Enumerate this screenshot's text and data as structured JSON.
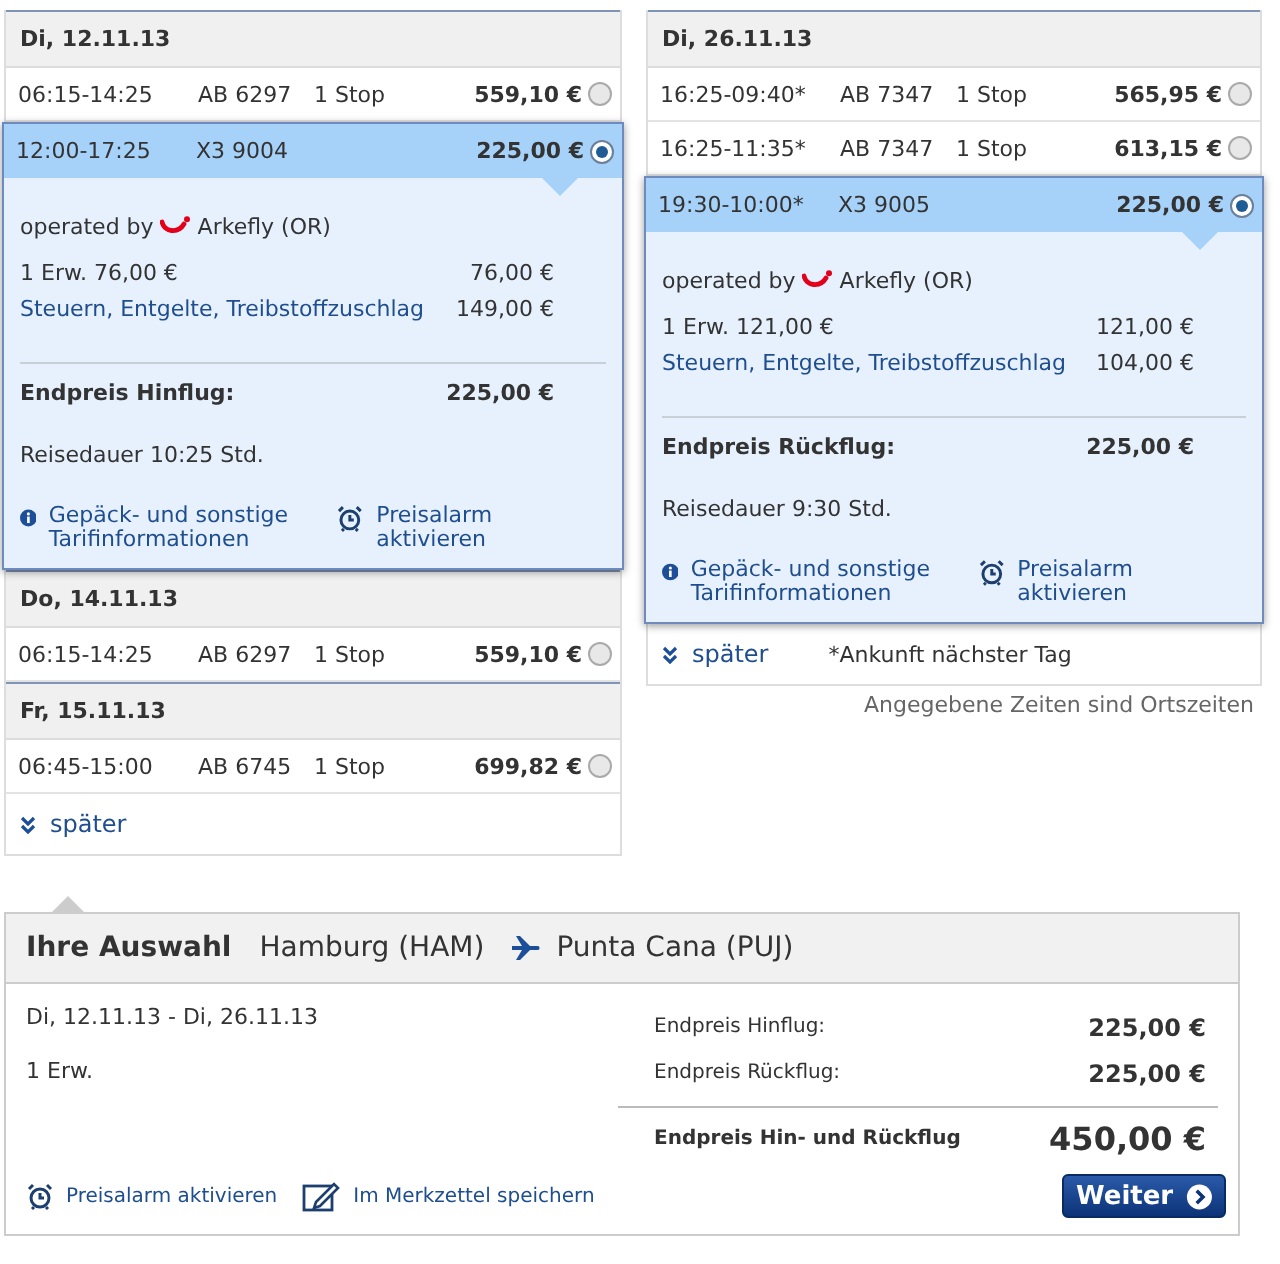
{
  "columns": [
    {
      "days": [
        {
          "date": "Di, 12.11.13",
          "flights": [
            {
              "times": "06:15-14:25",
              "code": "AB 6297",
              "stops": "1 Stop",
              "price": "559,10 €",
              "selected": false
            },
            {
              "times": "12:00-17:25",
              "code": "X3 9004",
              "price": "225,00 €",
              "selected": true,
              "details": {
                "operated_by": "operated by",
                "airline": "Arkefly (OR)",
                "fare_label": "1 Erw. 76,00 €",
                "fare_amount": "76,00 €",
                "taxes_label": "Steuern, Entgelte, Treibstoffzuschlag",
                "taxes_amount": "149,00 €",
                "total_label": "Endpreis Hinflug:",
                "total_amount": "225,00 €",
                "duration": "Reisedauer 10:25 Std.",
                "info_link": "Gepäck- und sonstige Tarifinformationen",
                "alarm_link": "Preisalarm aktivieren"
              }
            }
          ]
        },
        {
          "date": "Do, 14.11.13",
          "flights": [
            {
              "times": "06:15-14:25",
              "code": "AB 6297",
              "stops": "1 Stop",
              "price": "559,10 €",
              "selected": false
            }
          ]
        },
        {
          "date": "Fr, 15.11.13",
          "flights": [
            {
              "times": "06:45-15:00",
              "code": "AB 6745",
              "stops": "1 Stop",
              "price": "699,82 €",
              "selected": false
            }
          ]
        }
      ],
      "later": "später"
    },
    {
      "days": [
        {
          "date": "Di, 26.11.13",
          "flights": [
            {
              "times": "16:25-09:40*",
              "code": "AB 7347",
              "stops": "1 Stop",
              "price": "565,95 €",
              "selected": false
            },
            {
              "times": "16:25-11:35*",
              "code": "AB 7347",
              "stops": "1 Stop",
              "price": "613,15 €",
              "selected": false
            },
            {
              "times": "19:30-10:00*",
              "code": "X3 9005",
              "price": "225,00 €",
              "selected": true,
              "details": {
                "operated_by": "operated by",
                "airline": "Arkefly (OR)",
                "fare_label": "1 Erw. 121,00 €",
                "fare_amount": "121,00 €",
                "taxes_label": "Steuern, Entgelte, Treibstoffzuschlag",
                "taxes_amount": "104,00 €",
                "total_label": "Endpreis Rückflug:",
                "total_amount": "225,00 €",
                "duration": "Reisedauer 9:30 Std.",
                "info_link": "Gepäck- und sonstige Tarifinformationen",
                "alarm_link": "Preisalarm aktivieren"
              }
            }
          ]
        }
      ],
      "later": "später",
      "footnote": "*Ankunft nächster Tag",
      "note": "Angegebene Zeiten sind Ortszeiten"
    }
  ],
  "summary": {
    "title": "Ihre Auswahl",
    "from": "Hamburg (HAM)",
    "to": "Punta Cana (PUJ)",
    "dates": "Di, 12.11.13 - Di, 26.11.13",
    "travellers": "1 Erw.",
    "prices": [
      {
        "label": "Endpreis Hinflug:",
        "amount": "225,00 €"
      },
      {
        "label": "Endpreis Rückflug:",
        "amount": "225,00 €"
      }
    ],
    "total": {
      "label": "Endpreis Hin- und Rückflug",
      "amount": "450,00 €"
    },
    "links": [
      {
        "kind": "alarm",
        "label": "Preisalarm aktivieren"
      },
      {
        "kind": "notepad",
        "label": "Im Merkzettel speichern"
      }
    ],
    "button": "Weiter"
  }
}
